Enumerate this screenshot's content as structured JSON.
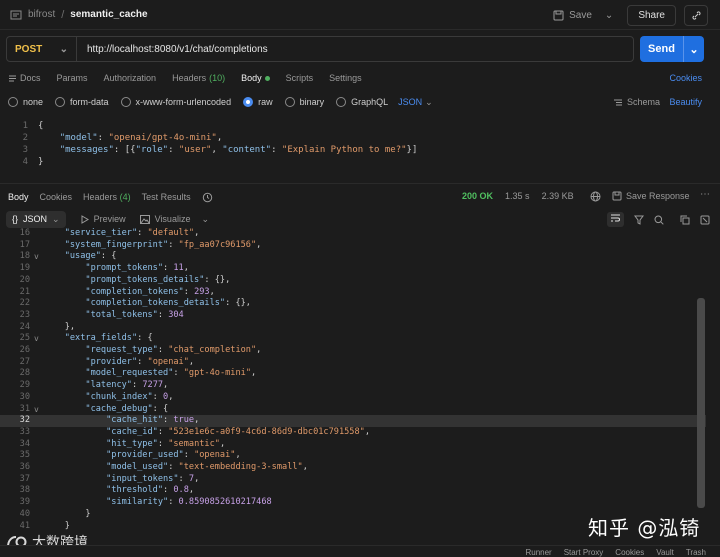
{
  "breadcrumb": {
    "workspace": "bifrost",
    "separator": "/",
    "request_name": "semantic_cache"
  },
  "top_actions": {
    "save": "Save",
    "share": "Share"
  },
  "request": {
    "method": "POST",
    "url": "http://localhost:8080/v1/chat/completions",
    "send": "Send"
  },
  "request_tabs": [
    {
      "label": "Docs"
    },
    {
      "label": "Params"
    },
    {
      "label": "Authorization"
    },
    {
      "label": "Headers",
      "count": "(10)"
    },
    {
      "label": "Body"
    },
    {
      "label": "Scripts"
    },
    {
      "label": "Settings"
    }
  ],
  "cookies_link": "Cookies",
  "body_types": [
    "none",
    "form-data",
    "x-www-form-urlencoded",
    "raw",
    "binary",
    "GraphQL"
  ],
  "body_format": "JSON",
  "schema_label": "Schema",
  "beautify_label": "Beautify",
  "request_body_lines": [
    {
      "n": "1",
      "t": "{"
    },
    {
      "n": "2",
      "t": "    \"model\": \"openai/gpt-4o-mini\","
    },
    {
      "n": "3",
      "t": "    \"messages\": [{\"role\": \"user\", \"content\": \"Explain Python to me?\"}]"
    },
    {
      "n": "4",
      "t": "}"
    }
  ],
  "response_tabs": [
    {
      "label": "Body"
    },
    {
      "label": "Cookies"
    },
    {
      "label": "Headers",
      "count": "(4)"
    },
    {
      "label": "Test Results"
    }
  ],
  "response_status": {
    "code": "200 OK",
    "time": "1.35 s",
    "size": "2.39 KB"
  },
  "save_response": "Save Response",
  "response_view": {
    "format": "JSON",
    "preview": "Preview",
    "visualize": "Visualize"
  },
  "response_lines": [
    {
      "n": "16",
      "t": "    \"service_tier\": \"default\",",
      "fold": ""
    },
    {
      "n": "17",
      "t": "    \"system_fingerprint\": \"fp_aa07c96156\",",
      "fold": ""
    },
    {
      "n": "18",
      "t": "    \"usage\": {",
      "fold": "v"
    },
    {
      "n": "19",
      "t": "        \"prompt_tokens\": 11,",
      "fold": ""
    },
    {
      "n": "20",
      "t": "        \"prompt_tokens_details\": {},",
      "fold": ""
    },
    {
      "n": "21",
      "t": "        \"completion_tokens\": 293,",
      "fold": ""
    },
    {
      "n": "22",
      "t": "        \"completion_tokens_details\": {},",
      "fold": ""
    },
    {
      "n": "23",
      "t": "        \"total_tokens\": 304",
      "fold": ""
    },
    {
      "n": "24",
      "t": "    },",
      "fold": ""
    },
    {
      "n": "25",
      "t": "    \"extra_fields\": {",
      "fold": "v"
    },
    {
      "n": "26",
      "t": "        \"request_type\": \"chat_completion\",",
      "fold": ""
    },
    {
      "n": "27",
      "t": "        \"provider\": \"openai\",",
      "fold": ""
    },
    {
      "n": "28",
      "t": "        \"model_requested\": \"gpt-4o-mini\",",
      "fold": ""
    },
    {
      "n": "29",
      "t": "        \"latency\": 7277,",
      "fold": ""
    },
    {
      "n": "30",
      "t": "        \"chunk_index\": 0,",
      "fold": ""
    },
    {
      "n": "31",
      "t": "        \"cache_debug\": {",
      "fold": "v"
    },
    {
      "n": "32",
      "t": "            \"cache_hit\": true,",
      "fold": "",
      "hl": true
    },
    {
      "n": "33",
      "t": "            \"cache_id\": \"523e1e6c-a0f9-4c6d-86d9-dbc01c791558\",",
      "fold": ""
    },
    {
      "n": "34",
      "t": "            \"hit_type\": \"semantic\",",
      "fold": ""
    },
    {
      "n": "35",
      "t": "            \"provider_used\": \"openai\",",
      "fold": ""
    },
    {
      "n": "36",
      "t": "            \"model_used\": \"text-embedding-3-small\",",
      "fold": ""
    },
    {
      "n": "37",
      "t": "            \"input_tokens\": 7,",
      "fold": ""
    },
    {
      "n": "38",
      "t": "            \"threshold\": 0.8,",
      "fold": ""
    },
    {
      "n": "39",
      "t": "            \"similarity\": 0.8590852610217468",
      "fold": ""
    },
    {
      "n": "40",
      "t": "        }",
      "fold": ""
    },
    {
      "n": "41",
      "t": "    }",
      "fold": ""
    }
  ],
  "bottom_items": [
    "Runner",
    "Start Proxy",
    "Cookies",
    "Vault",
    "Trash"
  ],
  "watermarks": {
    "zhihu": "知乎 @泓锜",
    "logo": "大数跨境"
  }
}
